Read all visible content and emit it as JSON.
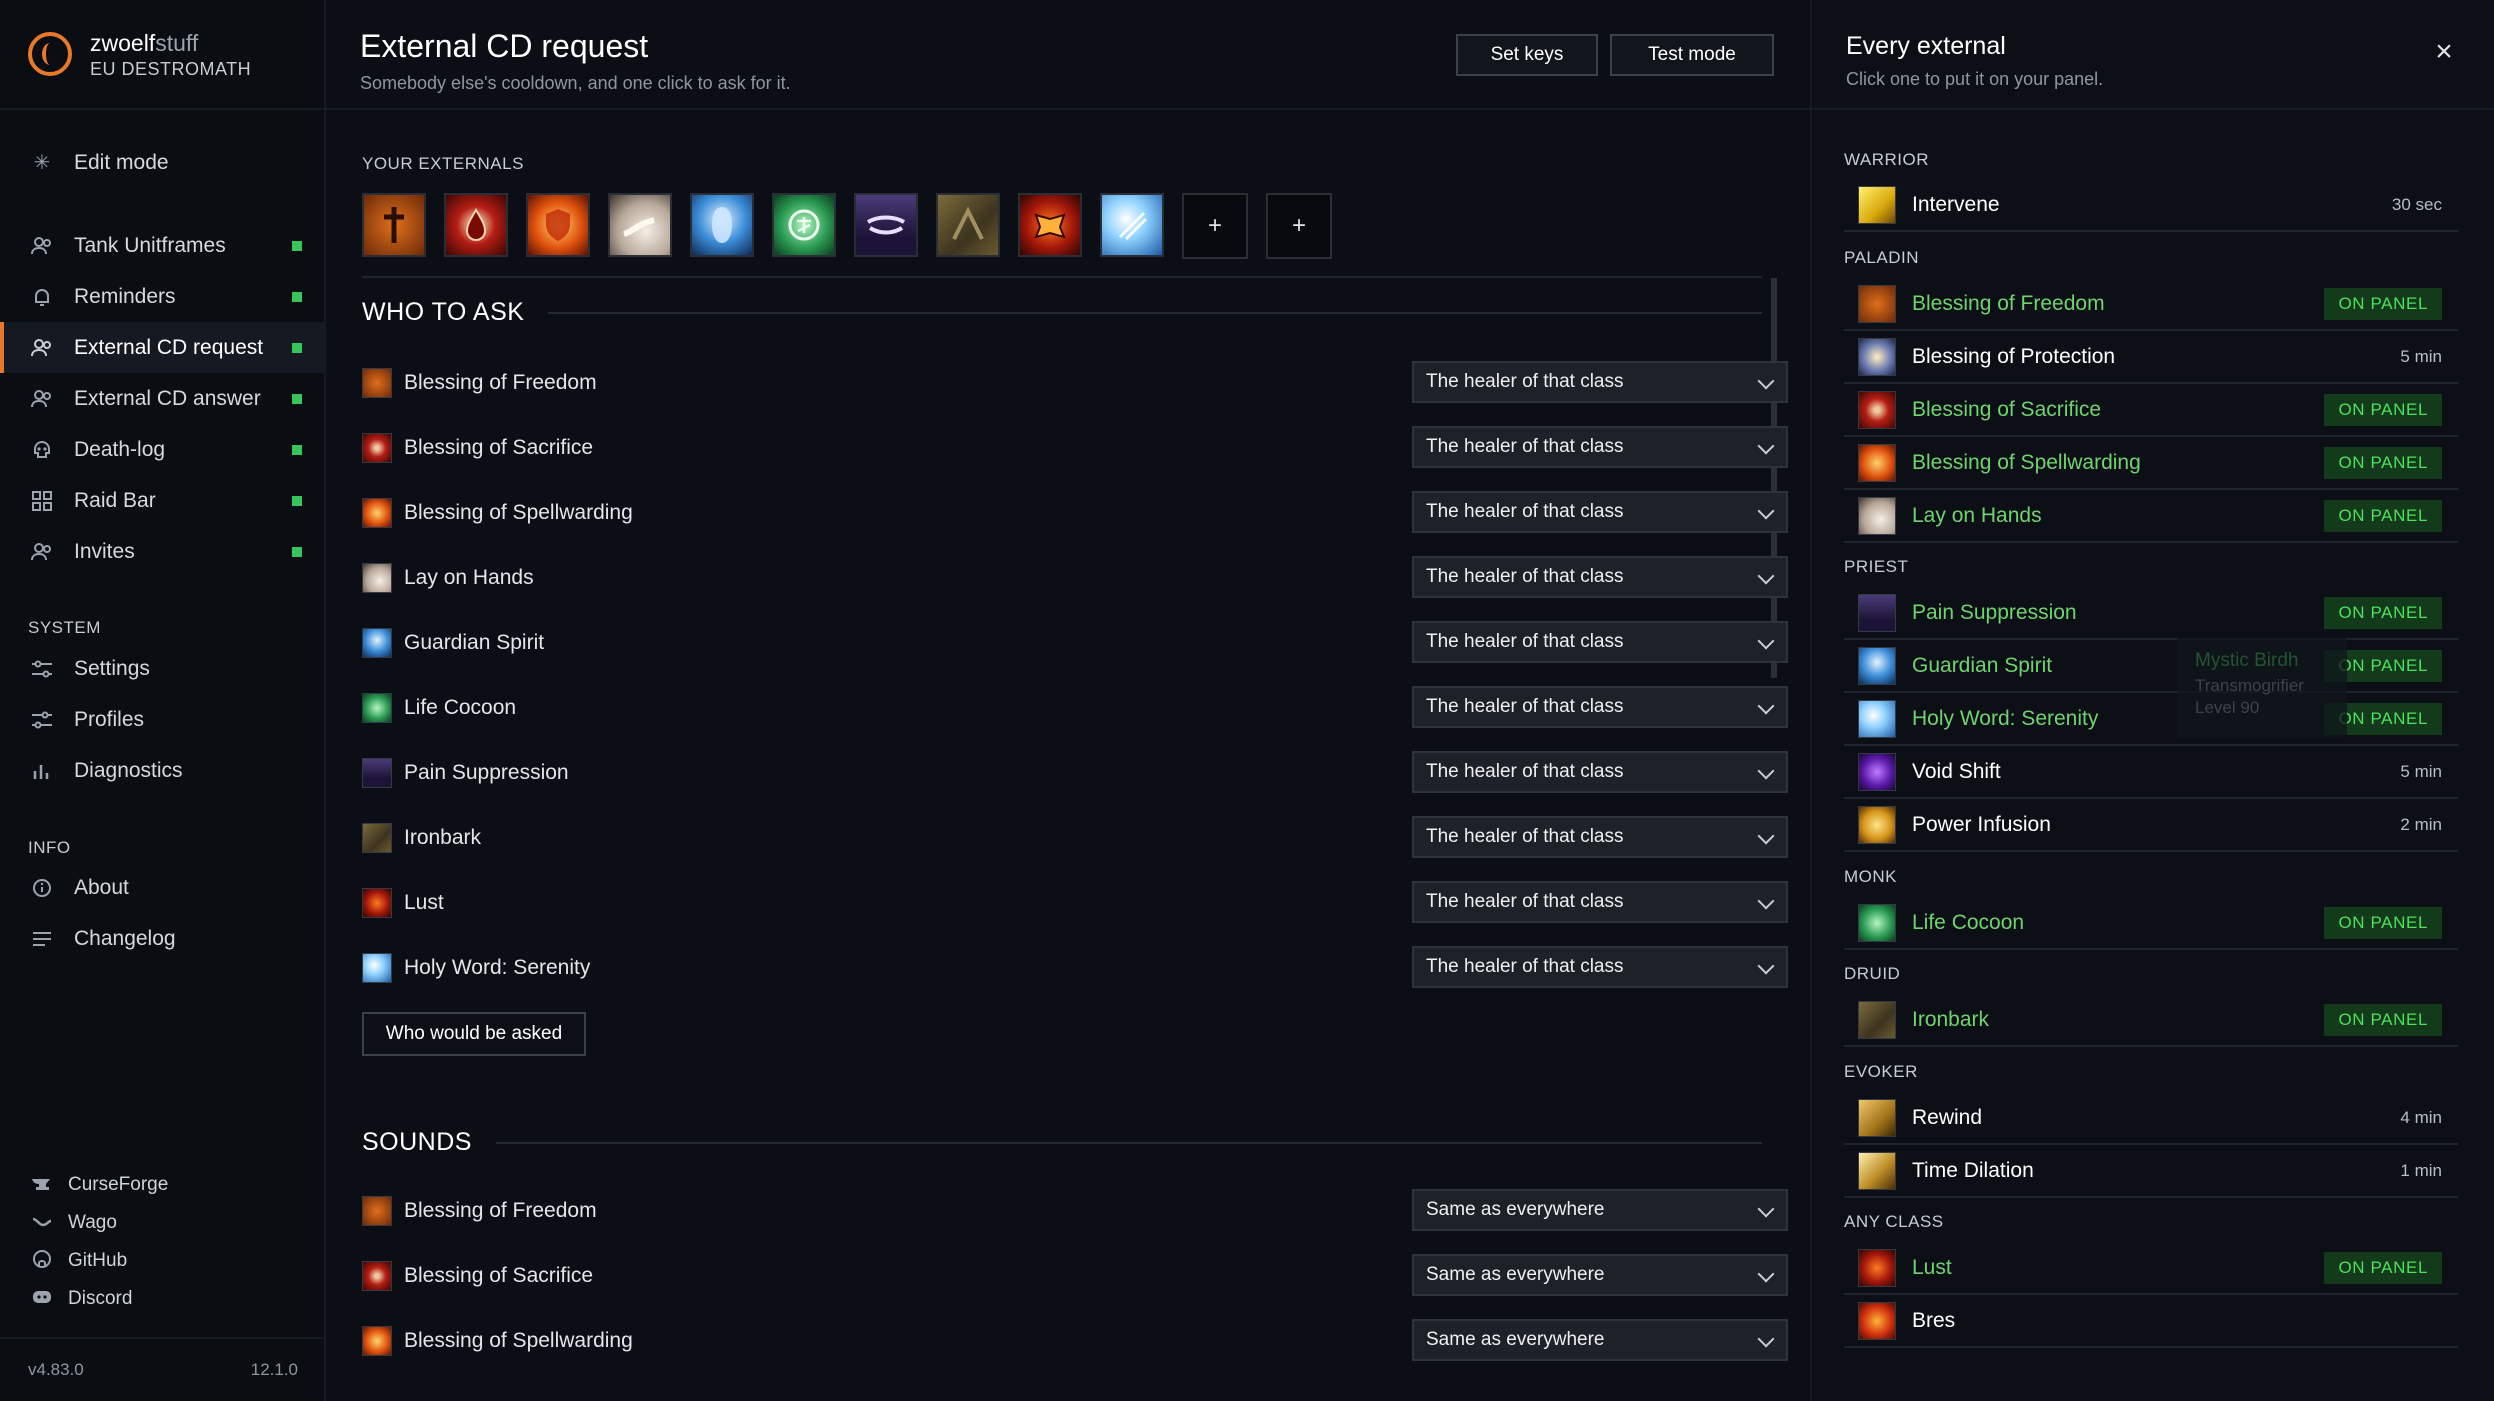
{
  "brand": {
    "name_bold": "zwoelf",
    "name_thin": "stuff",
    "realm": "EU DESTROMATH"
  },
  "sidebar": {
    "edit_mode": "Edit mode",
    "items": [
      {
        "label": "Tank Unitframes",
        "icon": "users-icon"
      },
      {
        "label": "Reminders",
        "icon": "bell-icon"
      },
      {
        "label": "External CD request",
        "icon": "users-icon",
        "active": true
      },
      {
        "label": "External CD answer",
        "icon": "users-icon"
      },
      {
        "label": "Death-log",
        "icon": "skull-icon"
      },
      {
        "label": "Raid Bar",
        "icon": "grid-icon"
      },
      {
        "label": "Invites",
        "icon": "users-icon"
      }
    ],
    "system_label": "SYSTEM",
    "system": [
      "Settings",
      "Profiles",
      "Diagnostics"
    ],
    "info_label": "INFO",
    "info": [
      "About",
      "Changelog"
    ],
    "links": [
      "CurseForge",
      "Wago",
      "GitHub",
      "Discord"
    ],
    "version": "v4.83.0",
    "game_version": "12.1.0"
  },
  "main": {
    "title": "External CD request",
    "subtitle": "Somebody else's cooldown, and one click to ask for it.",
    "set_keys": "Set keys",
    "test_mode": "Test mode",
    "your_externals": "YOUR EXTERNALS",
    "add": "+",
    "who_to_ask": "WHO TO ASK",
    "who_rows": [
      {
        "name": "Blessing of Freedom",
        "value": "The healer of that class"
      },
      {
        "name": "Blessing of Sacrifice",
        "value": "The healer of that class"
      },
      {
        "name": "Blessing of Spellwarding",
        "value": "The healer of that class"
      },
      {
        "name": "Lay on Hands",
        "value": "The healer of that class"
      },
      {
        "name": "Guardian Spirit",
        "value": "The healer of that class"
      },
      {
        "name": "Life Cocoon",
        "value": "The healer of that class"
      },
      {
        "name": "Pain Suppression",
        "value": "The healer of that class"
      },
      {
        "name": "Ironbark",
        "value": "The healer of that class"
      },
      {
        "name": "Lust",
        "value": "The healer of that class"
      },
      {
        "name": "Holy Word: Serenity",
        "value": "The healer of that class"
      }
    ],
    "who_button": "Who would be asked",
    "sounds": "SOUNDS",
    "sound_rows": [
      {
        "name": "Blessing of Freedom",
        "value": "Same as everywhere"
      },
      {
        "name": "Blessing of Sacrifice",
        "value": "Same as everywhere"
      },
      {
        "name": "Blessing of Spellwarding",
        "value": "Same as everywhere"
      }
    ]
  },
  "panel": {
    "title": "Every external",
    "subtitle": "Click one to put it on your panel.",
    "close": "×",
    "on_panel": "ON PANEL",
    "classes": {
      "warrior": "WARRIOR",
      "paladin": "PALADIN",
      "priest": "PRIEST",
      "monk": "MONK",
      "druid": "DRUID",
      "evoker": "EVOKER",
      "any": "ANY CLASS"
    },
    "spells": {
      "intervene": {
        "name": "Intervene",
        "dur": "30 sec"
      },
      "freedom": {
        "name": "Blessing of Freedom"
      },
      "protection": {
        "name": "Blessing of Protection",
        "dur": "5 min"
      },
      "sacrifice": {
        "name": "Blessing of Sacrifice"
      },
      "spellwarding": {
        "name": "Blessing of Spellwarding"
      },
      "layonhands": {
        "name": "Lay on Hands"
      },
      "painsup": {
        "name": "Pain Suppression"
      },
      "guardian": {
        "name": "Guardian Spirit"
      },
      "serenity": {
        "name": "Holy Word: Serenity"
      },
      "voidshift": {
        "name": "Void Shift",
        "dur": "5 min"
      },
      "powerinf": {
        "name": "Power Infusion",
        "dur": "2 min"
      },
      "cocoon": {
        "name": "Life Cocoon"
      },
      "ironbark": {
        "name": "Ironbark"
      },
      "rewind": {
        "name": "Rewind",
        "dur": "4 min"
      },
      "timedil": {
        "name": "Time Dilation",
        "dur": "1 min"
      },
      "lust": {
        "name": "Lust"
      },
      "bres": {
        "name": "Bres"
      }
    },
    "tooltip": {
      "name": "Mystic Birdh",
      "line2": "Transmogrifier",
      "line3": "Level 90"
    }
  },
  "colors": {
    "accent": "#e8792b",
    "status_green": "#37c45a",
    "on_panel_text": "#6fd36f"
  }
}
